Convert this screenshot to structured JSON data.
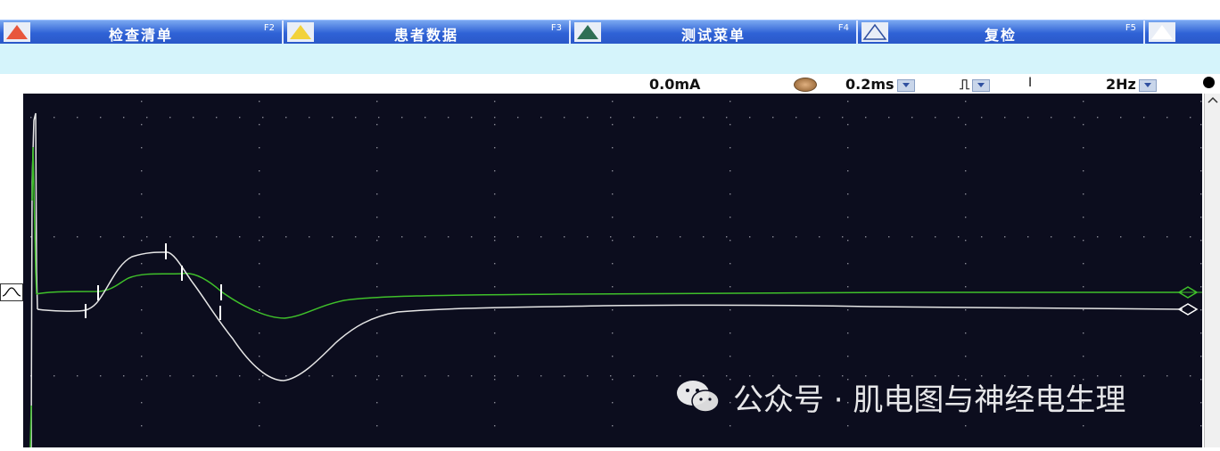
{
  "toolbar": {
    "keys": [
      {
        "label": "检查清单",
        "fkey": "F2",
        "triangle_color": "#e8563c"
      },
      {
        "label": "患者数据",
        "fkey": "F3",
        "triangle_color": "#f2d23a"
      },
      {
        "label": "测试菜单",
        "fkey": "F4",
        "triangle_color": "#2f6f55"
      },
      {
        "label": "复检",
        "fkey": "F5",
        "triangle_color": "#eaf2ff"
      }
    ]
  },
  "status": {
    "current": "0.0mA",
    "duration": "0.2ms",
    "polarity_symbol": "⎍",
    "separator": "I",
    "rate": "2Hz"
  },
  "icons": {
    "stimulus_knob": "knob-icon",
    "waveform_marker": "waveform-icon",
    "record_dot": "record-dot-icon",
    "scroll_up": "chevron-up-icon",
    "wechat": "wechat-icon"
  },
  "watermark": {
    "text": "公众号 · 肌电图与神经电生理"
  },
  "colors": {
    "trace_green": "#3fc02a",
    "trace_white": "#e6e6e6",
    "plot_bg": "#0c0d1e",
    "toolbar_blue": "#2f62d6"
  }
}
